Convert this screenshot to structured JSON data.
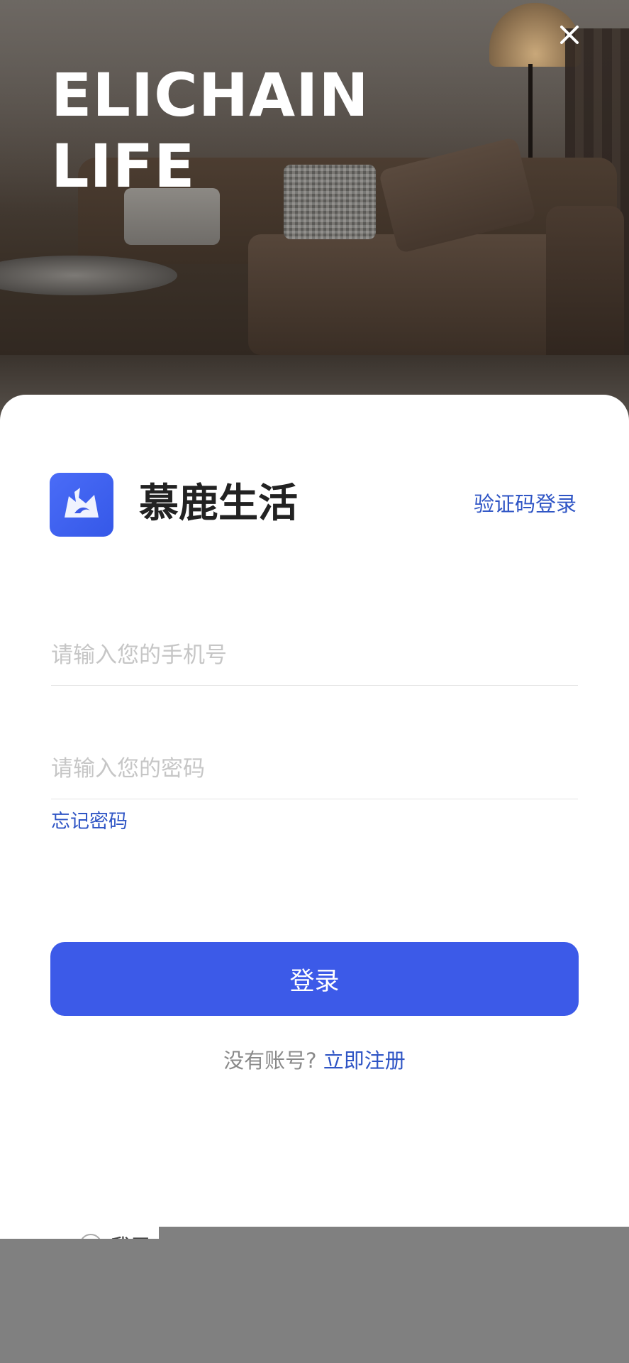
{
  "hero": {
    "title_line1": "ELICHAIN",
    "title_line2": "LIFE",
    "close_icon": "close-icon"
  },
  "card": {
    "app_name": "慕鹿生活",
    "app_logo_icon": "deer-logo-icon",
    "sms_login_label": "验证码登录",
    "phone_placeholder": "请输入您的手机号",
    "password_placeholder": "请输入您的密码",
    "forgot_label": "忘记密码",
    "login_label": "登录",
    "no_account_text": "没有账号?",
    "register_label": "立即注册",
    "agreement_text": "我已"
  },
  "colors": {
    "accent": "#3c5ae8",
    "link": "#2f55c5"
  }
}
